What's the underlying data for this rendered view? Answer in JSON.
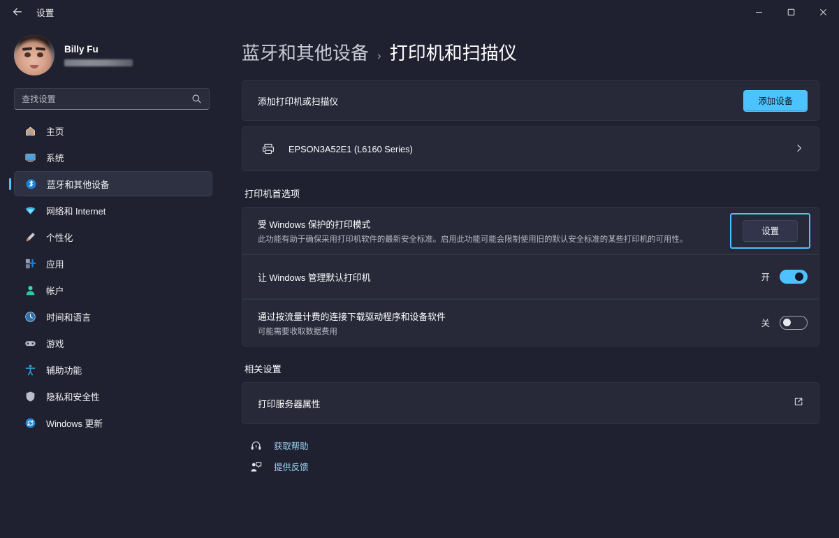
{
  "window": {
    "title": "设置",
    "back_icon": "back-arrow-icon",
    "minimize_label": "最小化",
    "maximize_label": "最大化",
    "close_label": "关闭"
  },
  "sidebar": {
    "account": {
      "name": "Billy Fu",
      "email_blurred": true,
      "avatar_alt": "用户头像"
    },
    "search": {
      "value": "",
      "placeholder": "查找设置",
      "icon": "search-icon"
    },
    "items": [
      {
        "label": "主页",
        "icon": "home-icon",
        "selected": false
      },
      {
        "label": "系统",
        "icon": "system-icon",
        "selected": false
      },
      {
        "label": "蓝牙和其他设备",
        "icon": "bluetooth-icon",
        "selected": true
      },
      {
        "label": "网络和 Internet",
        "icon": "wifi-icon",
        "selected": false
      },
      {
        "label": "个性化",
        "icon": "personalization-brush-icon",
        "selected": false
      },
      {
        "label": "应用",
        "icon": "apps-icon",
        "selected": false
      },
      {
        "label": "帐户",
        "icon": "account-icon",
        "selected": false
      },
      {
        "label": "时间和语言",
        "icon": "clock-icon",
        "selected": false
      },
      {
        "label": "游戏",
        "icon": "gamepad-icon",
        "selected": false
      },
      {
        "label": "辅助功能",
        "icon": "accessibility-icon",
        "selected": false
      },
      {
        "label": "隐私和安全性",
        "icon": "shield-icon",
        "selected": false
      },
      {
        "label": "Windows 更新",
        "icon": "update-icon",
        "selected": false
      }
    ]
  },
  "breadcrumb": {
    "parent": "蓝牙和其他设备",
    "separator": "›",
    "current": "打印机和扫描仪"
  },
  "main": {
    "add_printer": {
      "title": "添加打印机或扫描仪",
      "button_label": "添加设备"
    },
    "devices": [
      {
        "name": "EPSON3A52E1 (L6160 Series)",
        "icon": "printer-icon",
        "chevron": "chevron-right-icon"
      }
    ],
    "preferences_section": {
      "title": "打印机首选项",
      "rows": [
        {
          "title": "受 Windows 保护的打印模式",
          "subtitle": "此功能有助于确保采用打印机软件的最新安全标准。启用此功能可能会限制使用旧的默认安全标准的某些打印机的可用性。",
          "button_label": "设置",
          "highlighted": true
        },
        {
          "title": "让 Windows 管理默认打印机",
          "subtitle": "",
          "toggle_state_label": "开",
          "toggle_on": true
        },
        {
          "title": "通过按流量计费的连接下载驱动程序和设备软件",
          "subtitle": "可能需要收取数据费用",
          "toggle_state_label": "关",
          "toggle_on": false
        }
      ]
    },
    "related_section": {
      "title": "相关设置",
      "rows": [
        {
          "title": "打印服务器属性",
          "icon": "external-link-icon"
        }
      ]
    },
    "footer_links": [
      {
        "label": "获取帮助",
        "icon": "help-icon"
      },
      {
        "label": "提供反馈",
        "icon": "feedback-icon"
      }
    ]
  },
  "colors": {
    "page_background": "#202130",
    "card_background": "#272938",
    "accent": "#4cc2ff",
    "link": "#9ad6f5",
    "highlight_ring": "#4cc2ff",
    "text_primary": "#ffffff",
    "text_secondary": "#b7b9c2"
  }
}
